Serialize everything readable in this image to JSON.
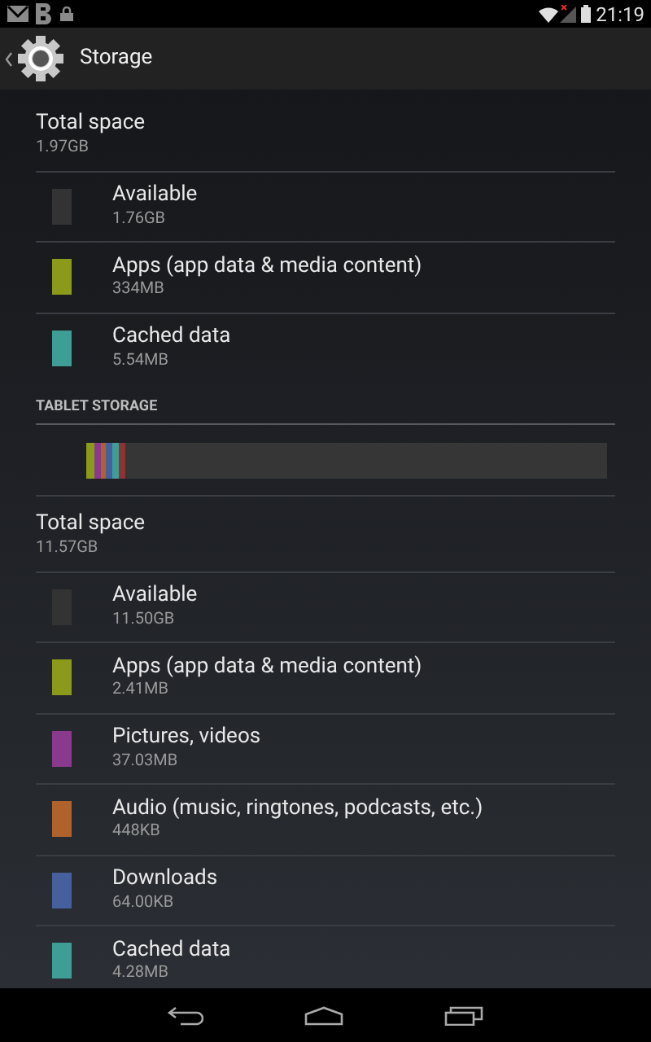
{
  "status_bar": {
    "time": "21:19"
  },
  "action_bar": {
    "title": "Storage"
  },
  "summary": {
    "title": "Total space",
    "value": "1.97GB",
    "items": [
      {
        "name": "Available",
        "value": "1.76GB",
        "color": "#333333"
      },
      {
        "name": "Apps (app data & media content)",
        "value": "334MB",
        "color": "#8c9a1c"
      },
      {
        "name": "Cached data",
        "value": "5.54MB",
        "color": "#3e9e96"
      }
    ]
  },
  "tablet_storage": {
    "header": "TABLET STORAGE",
    "segments": [
      {
        "color": "#8c9a1c",
        "level": 0.015
      },
      {
        "color": "#8a3a8c",
        "level": 0.012
      },
      {
        "color": "#b0622c",
        "level": 0.012
      },
      {
        "color": "#46609e",
        "level": 0.012
      },
      {
        "color": "#3e9e96",
        "level": 0.012
      },
      {
        "color": "#8c3434",
        "level": 0.012
      }
    ],
    "title": "Total space",
    "value": "11.57GB",
    "items": [
      {
        "name": "Available",
        "value": "11.50GB",
        "color": "#333333"
      },
      {
        "name": "Apps (app data & media content)",
        "value": "2.41MB",
        "color": "#8c9a1c"
      },
      {
        "name": "Pictures, videos",
        "value": "37.03MB",
        "color": "#8a3a8c"
      },
      {
        "name": "Audio (music, ringtones, podcasts, etc.)",
        "value": "448KB",
        "color": "#b0622c"
      },
      {
        "name": "Downloads",
        "value": "64.00KB",
        "color": "#46609e"
      },
      {
        "name": "Cached data",
        "value": "4.28MB",
        "color": "#3e9e96"
      }
    ]
  }
}
